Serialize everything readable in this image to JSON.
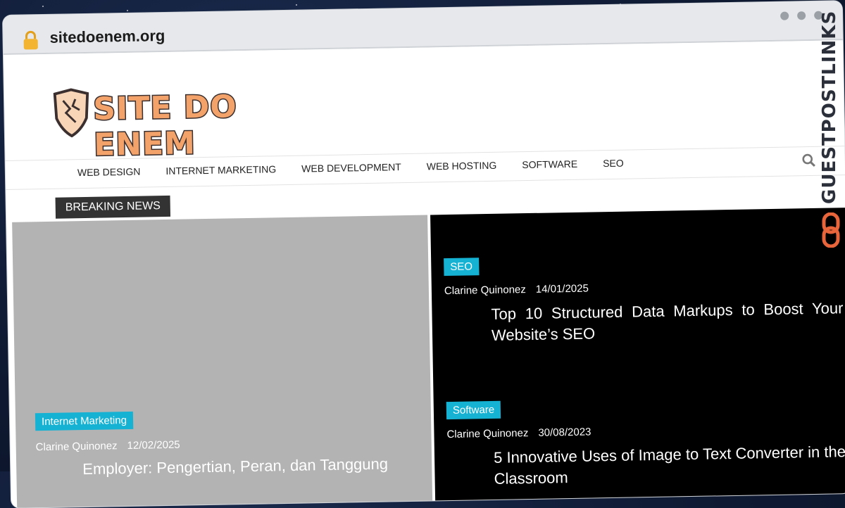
{
  "browser": {
    "url": "sitedoenem.org"
  },
  "site": {
    "logo_text": "SITE DO ENEM"
  },
  "nav": {
    "items": [
      "WEB DESIGN",
      "INTERNET MARKETING",
      "WEB DEVELOPMENT",
      "WEB HOSTING",
      "SOFTWARE",
      "SEO"
    ]
  },
  "breaking": {
    "label": "BREAKING NEWS"
  },
  "posts": {
    "left": {
      "category": "Internet Marketing",
      "author": "Clarine Quinonez",
      "date": "12/02/2025",
      "title": "Employer: Pengertian, Peran, dan Tanggung"
    },
    "right_top": {
      "category": "SEO",
      "author": "Clarine Quinonez",
      "date": "14/01/2025",
      "title": "Top 10 Structured Data Markups to Boost Your Website’s SEO"
    },
    "right_bottom": {
      "category": "Software",
      "author": "Clarine Quinonez",
      "date": "30/08/2023",
      "title": "5 Innovative Uses of Image to Text Converter in the Classroom"
    }
  },
  "watermark": {
    "text": "GUESTPOSTLINKS"
  },
  "colors": {
    "tag": "#16b2d4",
    "accent": "#f3a36a",
    "brand_icon": "#e8643a"
  },
  "icons": [
    "lock-icon",
    "search-icon",
    "logo-shield-icon",
    "link-icon"
  ]
}
